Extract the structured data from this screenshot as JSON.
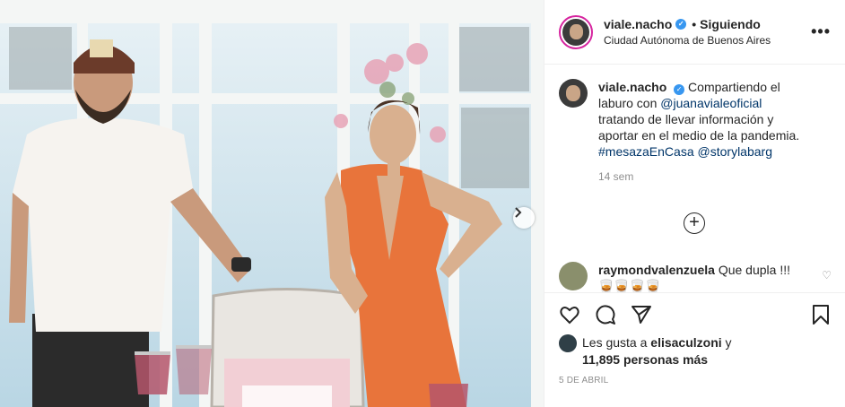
{
  "post": {
    "username": "viale.nacho",
    "follow_status": "Siguiendo",
    "location": "Ciudad Autónoma de Buenos Aires",
    "more_label": "•••"
  },
  "caption": {
    "username": "viale.nacho",
    "text_1": "Compartiendo el laburo con ",
    "mention_1": "@juanavialeoficial",
    "text_2": " tratando de llevar información y aportar en el medio de la pandemia. ",
    "hashtag": "#mesazaEnCasa",
    "mention_2": "@storylabarg",
    "time": "14 sem"
  },
  "comment": {
    "username": "raymondvalenzuela",
    "text": "Que dupla !!!🥃🥃🥃🥃"
  },
  "likes": {
    "prefix": "Les gusta a ",
    "user": "elisaculzoni",
    "mid": " y",
    "count": "11,895 personas más"
  },
  "date": "5 DE ABRIL",
  "icons": {
    "like": "heart-icon",
    "comment": "comment-icon",
    "share": "share-icon",
    "save": "bookmark-icon",
    "load_more": "plus-circle-icon",
    "next": "chevron-right-icon"
  },
  "colors": {
    "accent_link": "#003569",
    "verified": "#3897f0",
    "muted": "#8e8e8e",
    "dress": "#e8743b"
  }
}
